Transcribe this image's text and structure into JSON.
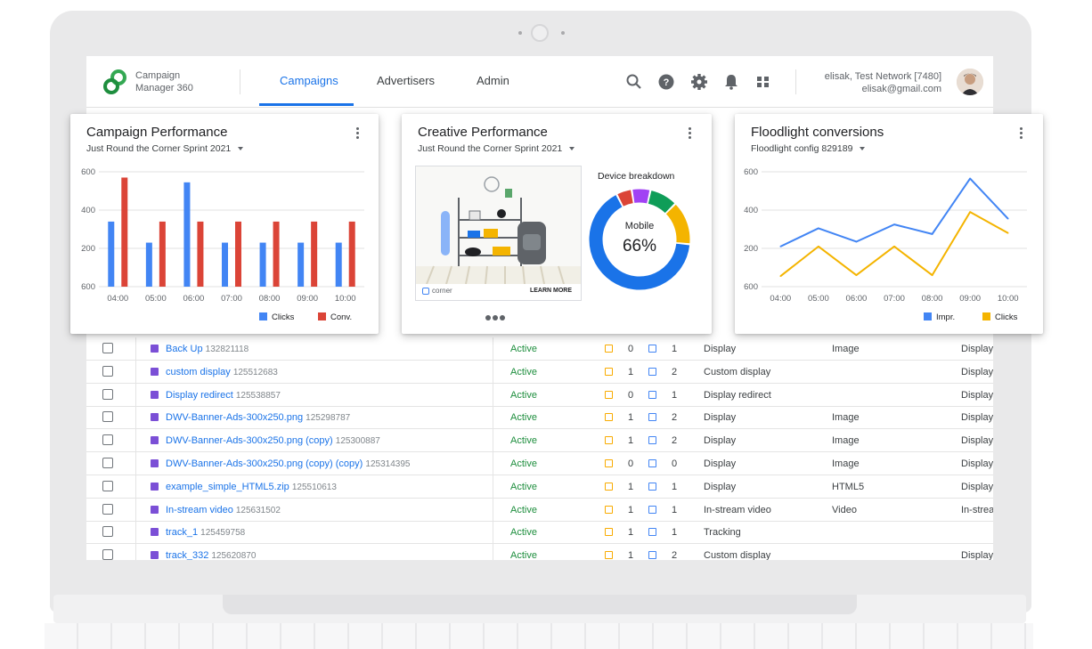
{
  "app": {
    "brand_line1": "Campaign",
    "brand_line2": "Manager 360",
    "nav": [
      {
        "label": "Campaigns",
        "active": true
      },
      {
        "label": "Advertisers",
        "active": false
      },
      {
        "label": "Admin",
        "active": false
      }
    ],
    "toolbar_icons": [
      "search-icon",
      "help-icon",
      "settings-icon",
      "notifications-icon",
      "apps-icon"
    ],
    "user": {
      "name": "elisak, Test Network [7480]",
      "email": "elisak@gmail.com"
    }
  },
  "colors": {
    "blue": "#4285f4",
    "red": "#db4437",
    "orange": "#f4b400",
    "green": "#0f9d58",
    "purple": "#a142f4",
    "status_green": "#1e8e3e"
  },
  "cards": {
    "campaign": {
      "title": "Campaign Performance",
      "subtitle": "Just Round the Corner Sprint 2021",
      "legend": [
        "Clicks",
        "Conv."
      ]
    },
    "creative": {
      "title": "Creative Performance",
      "subtitle": "Just Round the Corner Sprint 2021",
      "ad_brand": "corner",
      "ad_cta": "LEARN MORE",
      "device_title": "Device breakdown",
      "donut_label": "Mobile",
      "donut_value": "66%"
    },
    "floodlight": {
      "title": "Floodlight conversions",
      "subtitle": "Floodlight config 829189",
      "legend": [
        "Impr.",
        "Clicks"
      ]
    }
  },
  "chart_data": [
    {
      "type": "bar",
      "categories": [
        "04:00",
        "05:00",
        "06:00",
        "07:00",
        "08:00",
        "09:00",
        "10:00"
      ],
      "y_ticks": [
        "600",
        "400",
        "200",
        "600"
      ],
      "series": [
        {
          "name": "Clicks",
          "color": "#4285f4",
          "values": [
            340,
            230,
            545,
            230,
            230,
            230,
            230
          ]
        },
        {
          "name": "Conv.",
          "color": "#db4437",
          "values": [
            570,
            340,
            340,
            340,
            340,
            340,
            340
          ]
        }
      ],
      "ylim": [
        0,
        600
      ],
      "legend_position": "bottom-right",
      "grid": true
    },
    {
      "type": "pie",
      "donut": true,
      "slices": [
        {
          "label": "Mobile",
          "value": 66,
          "color": "#1a73e8"
        },
        {
          "value": 5,
          "color": "#db4437"
        },
        {
          "value": 6,
          "color": "#a142f4"
        },
        {
          "value": 9,
          "color": "#0f9d58"
        },
        {
          "value": 14,
          "color": "#f4b400"
        }
      ]
    },
    {
      "type": "line",
      "x": [
        "04:00",
        "05:00",
        "06:00",
        "07:00",
        "08:00",
        "09:00",
        "10:00"
      ],
      "y_ticks": [
        "600",
        "400",
        "200",
        "600"
      ],
      "series": [
        {
          "name": "Impr.",
          "color": "#4285f4",
          "values": [
            210,
            305,
            235,
            325,
            275,
            565,
            355
          ]
        },
        {
          "name": "Clicks",
          "color": "#f4b400",
          "values": [
            55,
            210,
            60,
            210,
            60,
            390,
            280
          ]
        }
      ],
      "ylim": [
        0,
        600
      ],
      "legend_position": "bottom-right",
      "grid": true
    }
  ],
  "table": {
    "rows": [
      {
        "name": "Back Up",
        "id": "132821118",
        "status": "Active",
        "c1": "0",
        "c2": "1",
        "type": "Display",
        "format": "Image",
        "env": "Display"
      },
      {
        "name": "custom display",
        "id": "125512683",
        "status": "Active",
        "c1": "1",
        "c2": "2",
        "type": "Custom display",
        "format": "",
        "env": "Display"
      },
      {
        "name": "Display redirect",
        "id": "125538857",
        "status": "Active",
        "c1": "0",
        "c2": "1",
        "type": "Display redirect",
        "format": "",
        "env": "Display"
      },
      {
        "name": "DWV-Banner-Ads-300x250.png",
        "id": "125298787",
        "status": "Active",
        "c1": "1",
        "c2": "2",
        "type": "Display",
        "format": "Image",
        "env": "Display"
      },
      {
        "name": "DWV-Banner-Ads-300x250.png (copy)",
        "id": "125300887",
        "status": "Active",
        "c1": "1",
        "c2": "2",
        "type": "Display",
        "format": "Image",
        "env": "Display"
      },
      {
        "name": "DWV-Banner-Ads-300x250.png (copy) (copy)",
        "id": "125314395",
        "status": "Active",
        "c1": "0",
        "c2": "0",
        "type": "Display",
        "format": "Image",
        "env": "Display"
      },
      {
        "name": "example_simple_HTML5.zip",
        "id": "125510613",
        "status": "Active",
        "c1": "1",
        "c2": "1",
        "type": "Display",
        "format": "HTML5",
        "env": "Display"
      },
      {
        "name": "In-stream video",
        "id": "125631502",
        "status": "Active",
        "c1": "1",
        "c2": "1",
        "type": "In-stream video",
        "format": "Video",
        "env": "In-strea"
      },
      {
        "name": "track_1",
        "id": "125459758",
        "status": "Active",
        "c1": "1",
        "c2": "1",
        "type": "Tracking",
        "format": "",
        "env": ""
      },
      {
        "name": "track_332",
        "id": "125620870",
        "status": "Active",
        "c1": "1",
        "c2": "2",
        "type": "Custom display",
        "format": "",
        "env": "Display"
      }
    ]
  }
}
